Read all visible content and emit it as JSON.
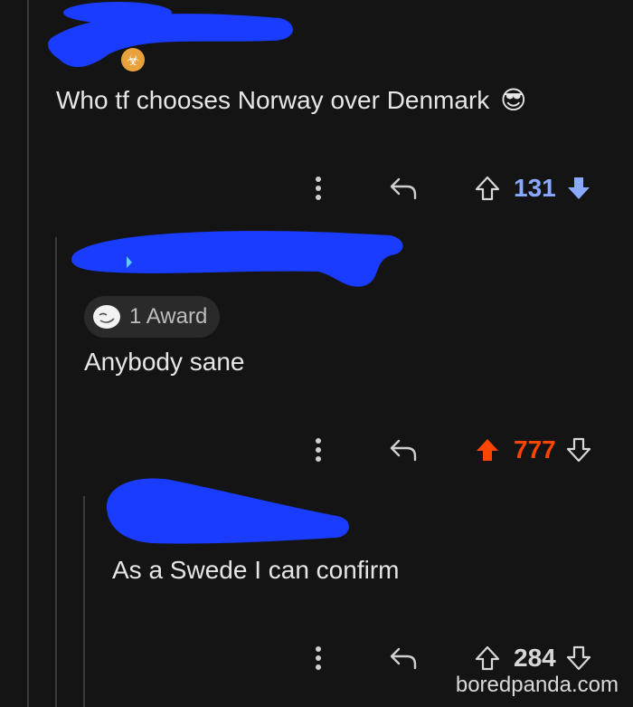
{
  "comments": [
    {
      "text": "Who tf chooses Norway over Denmark",
      "emoji": "😎",
      "flair_icon": "biohazard-flair-icon",
      "votes": {
        "count": "131",
        "state": "downvoted",
        "color": "#8aaaff"
      }
    },
    {
      "award": {
        "label": "1 Award",
        "icon": "award-face-icon"
      },
      "text": "Anybody sane",
      "votes": {
        "count": "777",
        "state": "upvoted",
        "color": "#ff4500"
      }
    },
    {
      "text": "As a Swede I can confirm",
      "votes": {
        "count": "284",
        "state": "none",
        "color": "#d7d7d7"
      }
    }
  ],
  "actions": {
    "more_icon": "more-vertical-icon",
    "reply_icon": "reply-icon"
  },
  "watermark": "boredpanda.com",
  "redaction_color": "#1a3cff"
}
